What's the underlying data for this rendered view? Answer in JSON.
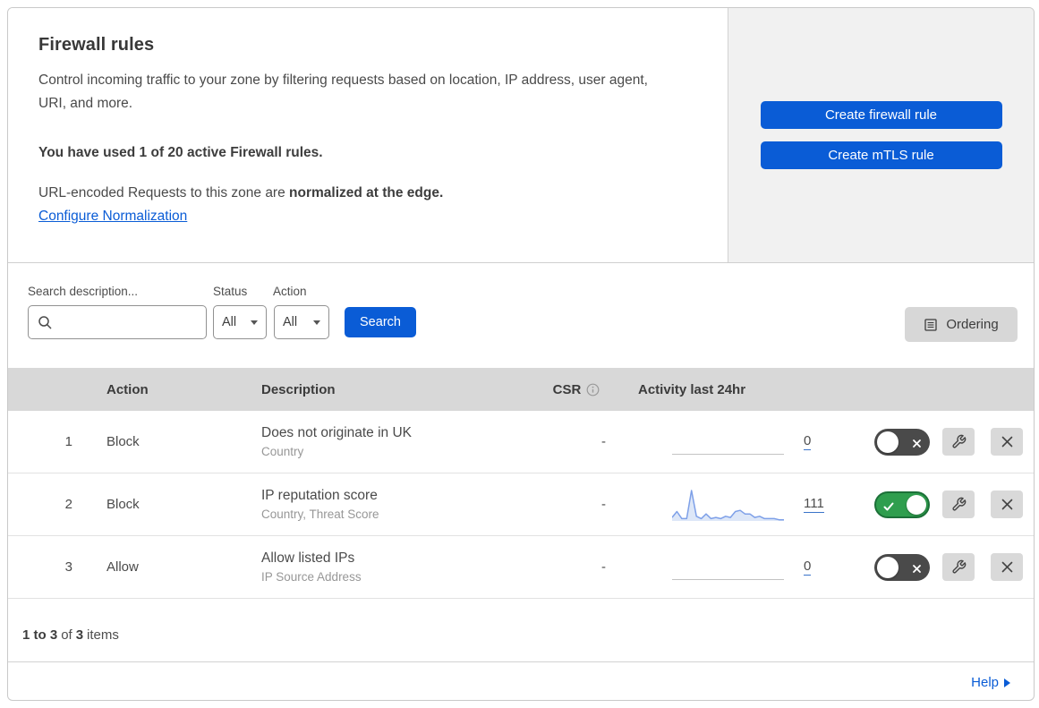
{
  "panel": {
    "title": "Firewall rules",
    "description": "Control incoming traffic to your zone by filtering requests based on location, IP address, user agent, URI, and more.",
    "usage_note": "You have used 1 of 20 active Firewall rules.",
    "normalization_prefix": "URL-encoded Requests to this zone are ",
    "normalization_emphasis": "normalized at the edge.",
    "normalization_link": "Configure Normalization",
    "create_firewall_button": "Create firewall rule",
    "create_mtls_button": "Create mTLS rule"
  },
  "filters": {
    "search_label": "Search description...",
    "search_value": "",
    "status_label": "Status",
    "status_value": "All",
    "action_label": "Action",
    "action_value": "All",
    "search_button": "Search",
    "ordering_button": "Ordering"
  },
  "table": {
    "headers": {
      "action": "Action",
      "description": "Description",
      "csr": "CSR",
      "activity": "Activity last 24hr"
    },
    "rows": [
      {
        "priority": "1",
        "action": "Block",
        "description": "Does not originate in UK",
        "match_fields": "Country",
        "csr": "-",
        "activity_count": "0",
        "enabled": false
      },
      {
        "priority": "2",
        "action": "Block",
        "description": "IP reputation score",
        "match_fields": "Country, Threat Score",
        "csr": "-",
        "activity_count": "111",
        "enabled": true
      },
      {
        "priority": "3",
        "action": "Allow",
        "description": "Allow listed IPs",
        "match_fields": "IP Source Address",
        "csr": "-",
        "activity_count": "0",
        "enabled": false
      }
    ]
  },
  "footer": {
    "range": "1 to 3",
    "of": "of",
    "total": "3",
    "items": "items",
    "help_link": "Help"
  },
  "colors": {
    "primary_blue": "#0a5cd6",
    "cta_panel_bg": "#f1f1f1",
    "table_header_bg": "#d8d8d8",
    "toggle_on_green": "#2f9e4e",
    "toggle_off_gray": "#4a4a4a",
    "sparkline_stroke": "#7ea0e8",
    "sparkline_fill": "#dde7f8",
    "count_underline_blue": "#3b74c9"
  },
  "chart_data": {
    "type": "area",
    "title": "Activity last 24hr (rule 2 sparkline)",
    "x_unit": "hour",
    "values": [
      3,
      8,
      2,
      2,
      26,
      4,
      2,
      6,
      2,
      3,
      2,
      4,
      3,
      8,
      9,
      6,
      6,
      3,
      4,
      2,
      2,
      2,
      1,
      1
    ],
    "total": 111,
    "ylim": [
      0,
      26
    ],
    "grid": false,
    "legend": false
  }
}
